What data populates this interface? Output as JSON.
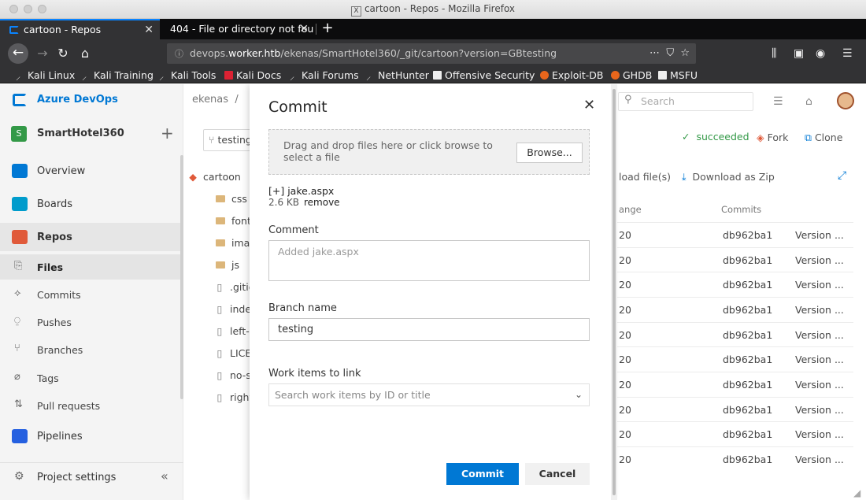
{
  "window": {
    "title": "cartoon - Repos - Mozilla Firefox"
  },
  "tabs": [
    {
      "label": "cartoon - Repos",
      "active": true
    },
    {
      "label": "404 - File or directory not fou",
      "active": false
    }
  ],
  "urlbar": {
    "prefix": "devops.",
    "host": "worker.htb",
    "path": "/ekenas/SmartHotel360/_git/cartoon?version=GBtesting"
  },
  "bookmarks": [
    {
      "label": "Kali Linux"
    },
    {
      "label": "Kali Training"
    },
    {
      "label": "Kali Tools"
    },
    {
      "label": "Kali Docs"
    },
    {
      "label": "Kali Forums"
    },
    {
      "label": "NetHunter"
    },
    {
      "label": "Offensive Security"
    },
    {
      "label": "Exploit-DB"
    },
    {
      "label": "GHDB"
    },
    {
      "label": "MSFU"
    }
  ],
  "sidebar": {
    "brand": "Azure DevOps",
    "project": "SmartHotel360",
    "project_initial": "S",
    "items": [
      {
        "label": "Overview"
      },
      {
        "label": "Boards"
      },
      {
        "label": "Repos"
      },
      {
        "label": "Pipelines"
      },
      {
        "label": "Project settings"
      }
    ],
    "subitems": [
      {
        "label": "Files"
      },
      {
        "label": "Commits"
      },
      {
        "label": "Pushes"
      },
      {
        "label": "Branches"
      },
      {
        "label": "Tags"
      },
      {
        "label": "Pull requests"
      }
    ]
  },
  "breadcrumb": {
    "org": "ekenas",
    "sep": "/"
  },
  "branch_selector": {
    "label": "testing"
  },
  "tree": [
    {
      "label": "cartoon",
      "kind": "repo"
    },
    {
      "label": "css",
      "kind": "folder"
    },
    {
      "label": "font",
      "kind": "folder"
    },
    {
      "label": "imag",
      "kind": "folder"
    },
    {
      "label": "js",
      "kind": "folder"
    },
    {
      "label": ".gitig",
      "kind": "file"
    },
    {
      "label": "inde",
      "kind": "file"
    },
    {
      "label": "left-",
      "kind": "file"
    },
    {
      "label": "LICE",
      "kind": "file"
    },
    {
      "label": "no-s",
      "kind": "file"
    },
    {
      "label": "right",
      "kind": "file"
    }
  ],
  "header_right": {
    "search_placeholder": "Search",
    "status": "succeeded",
    "fork": "Fork",
    "clone": "Clone",
    "upload": "load file(s)",
    "download": "Download as Zip",
    "col_change": "ange",
    "col_commits": "Commits"
  },
  "file_rows": [
    {
      "change": "20",
      "commit": "db962ba1",
      "message": "Version ..."
    },
    {
      "change": "20",
      "commit": "db962ba1",
      "message": "Version ..."
    },
    {
      "change": "20",
      "commit": "db962ba1",
      "message": "Version ..."
    },
    {
      "change": "20",
      "commit": "db962ba1",
      "message": "Version ..."
    },
    {
      "change": "20",
      "commit": "db962ba1",
      "message": "Version ..."
    },
    {
      "change": "20",
      "commit": "db962ba1",
      "message": "Version ..."
    },
    {
      "change": "20",
      "commit": "db962ba1",
      "message": "Version ..."
    },
    {
      "change": "20",
      "commit": "db962ba1",
      "message": "Version ..."
    },
    {
      "change": "20",
      "commit": "db962ba1",
      "message": "Version ..."
    },
    {
      "change": "20",
      "commit": "db962ba1",
      "message": "Version ..."
    }
  ],
  "modal": {
    "title": "Commit",
    "dropzone_text": "Drag and drop files here or click browse to select a file",
    "browse_label": "Browse...",
    "attached_file": "[+] jake.aspx",
    "attached_size": "2.6 KB",
    "remove_label": "remove",
    "comment_label": "Comment",
    "comment_placeholder": "Added jake.aspx",
    "branch_label": "Branch name",
    "branch_value": "testing",
    "workitems_label": "Work items to link",
    "workitems_placeholder": "Search work items by ID or title",
    "commit_button": "Commit",
    "cancel_button": "Cancel"
  },
  "colors": {
    "accent": "#0078d4",
    "success": "#339947",
    "firefox_dark": "#323234"
  }
}
